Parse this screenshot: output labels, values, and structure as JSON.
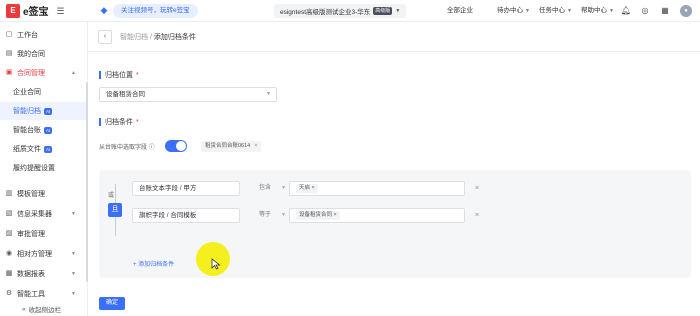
{
  "topbar": {
    "logo_mark": "E",
    "logo_text": "e签宝",
    "notice": "关注视频号，玩转e签宝",
    "tenant": "esigntest高级版测试企业3-华东",
    "tenant_badge": "高级版",
    "nav": [
      {
        "label": "全部企业"
      },
      {
        "label": "待办中心"
      },
      {
        "label": "任务中心"
      },
      {
        "label": "帮助中心"
      }
    ],
    "icons": [
      "bell-icon",
      "globe-icon",
      "grid-icon"
    ]
  },
  "sidebar": {
    "items": [
      {
        "label": "工作台",
        "icon": "desk-icon"
      },
      {
        "label": "我的合同",
        "icon": "contract-icon"
      },
      {
        "label": "合同管理",
        "icon": "manage-icon",
        "expanded": true
      },
      {
        "label": "企业合同",
        "sub": true
      },
      {
        "label": "智能归档",
        "sub": true,
        "badge": "AI",
        "active": true
      },
      {
        "label": "智能台账",
        "sub": true,
        "badge": "AI"
      },
      {
        "label": "纸质文件",
        "sub": true,
        "badge": "AI"
      },
      {
        "label": "履约提醒设置",
        "sub": true
      },
      {
        "label": "模板管理",
        "icon": "template-icon"
      },
      {
        "label": "信息采集器",
        "icon": "collector-icon"
      },
      {
        "label": "审批管理",
        "icon": "approval-icon"
      },
      {
        "label": "相对方管理",
        "icon": "counterpart-icon"
      },
      {
        "label": "数据报表",
        "icon": "report-icon"
      },
      {
        "label": "智能工具",
        "icon": "tool-icon"
      }
    ],
    "footer": "收起侧边栏"
  },
  "page": {
    "breadcrumb_parent": "智能归档",
    "breadcrumb_sep": " / ",
    "breadcrumb_current": "添加归档条件",
    "section_location": "归档位置",
    "required_mark": "*",
    "location_value": "设备租赁合同",
    "section_condition": "归档条件",
    "toggle_label": "从台账中选取字段",
    "toggle_on": true,
    "ledger_chip": "租赁合同台账0614",
    "or_label": "或",
    "and_label": "且",
    "conditions": [
      {
        "field": "台账文本字段 / 甲方",
        "operator": "包含",
        "value": "天启"
      },
      {
        "field": "旗帜字段 / 合同模板",
        "operator": "等于",
        "value": "设备租赁合同"
      }
    ],
    "add_condition": "+ 添加归档条件",
    "confirm": "确定"
  },
  "colors": {
    "accent": "#3a6ff7",
    "brand_red": "#e93b3d",
    "cursor_highlight": "#f6ef1e"
  }
}
